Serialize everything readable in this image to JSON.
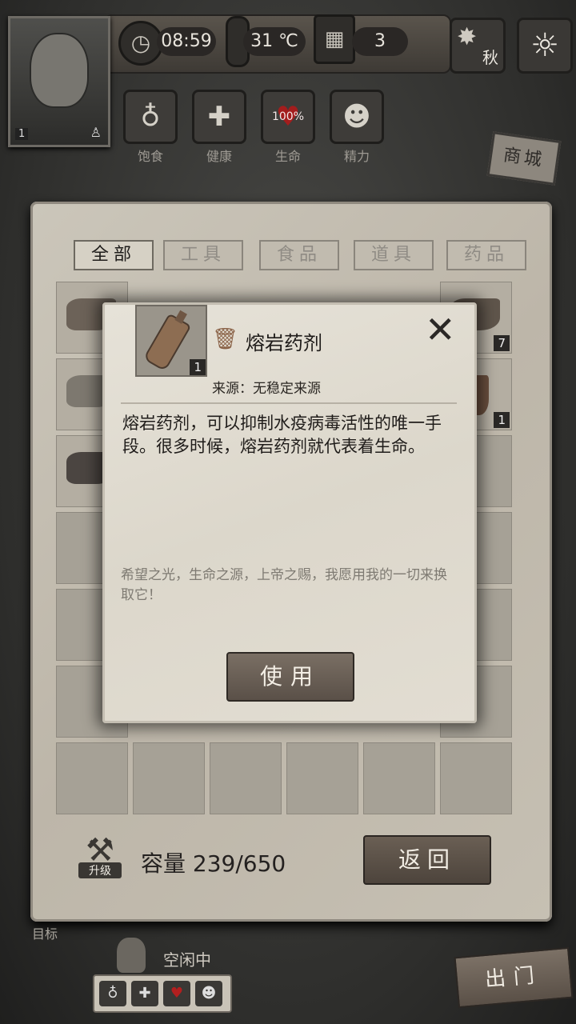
{
  "hud": {
    "time": "08:59",
    "temperature": "31 ℃",
    "day": "3",
    "season": "秋",
    "avatar_level": "1"
  },
  "stats": [
    {
      "label": "饱食",
      "icon": "stomach-icon"
    },
    {
      "label": "健康",
      "icon": "plus-icon"
    },
    {
      "label": "生命",
      "icon": "heart-icon",
      "value": "100%"
    },
    {
      "label": "精力",
      "icon": "person-icon"
    }
  ],
  "shop": {
    "label": "商城"
  },
  "tabs": [
    "全部",
    "工具",
    "食品",
    "道具",
    "药品"
  ],
  "inventory": {
    "counts": [
      "7",
      "1"
    ],
    "capacity_label": "容量",
    "capacity_value": "239/650",
    "upgrade_label": "升级",
    "return_label": "返回"
  },
  "bottom": {
    "target_label": "目标",
    "idle": "空闲中",
    "go_label": "出门"
  },
  "modal": {
    "title": "熔岩药剂",
    "quantity": "1",
    "source": "来源：无稳定来源",
    "description": "熔岩药剂，可以抑制水疫病毒活性的唯一手段。很多时候，熔岩药剂就代表着生命。",
    "flavor": "希望之光，生命之源，上帝之赐，我愿用我的一切来换取它！",
    "use_label": "使用",
    "close_label": "✕"
  },
  "colors": {
    "accent": "#5a5048",
    "paper": "#e2ddd2"
  }
}
